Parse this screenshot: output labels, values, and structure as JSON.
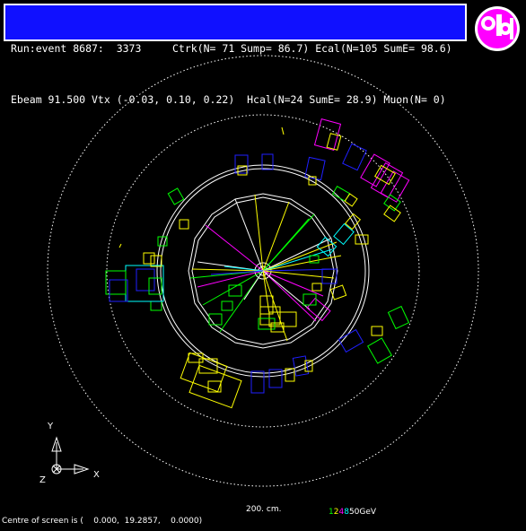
{
  "header": {
    "line1": "Run:event 8687:  3373     Ctrk(N= 71 Sump= 86.7) Ecal(N=105 SumE= 98.6)",
    "line2": "Ebeam 91.500 Vtx (-0.03, 0.10, 0.22)  Hcal(N=24 SumE= 28.9) Muon(N= 0)"
  },
  "axes": {
    "y": "Y",
    "x": "X",
    "z": "Z"
  },
  "scale_bar": {
    "label": "200. cm."
  },
  "energy_scale": {
    "n1": "1",
    "n2": "2",
    "n4": "4",
    "n8": "8",
    "n50": "50",
    "unit": "GeV"
  },
  "footer": {
    "centre_text": "Centre of screen is (    0.000,  19.2857,    0.0000)"
  },
  "colors": {
    "background": "#000000",
    "header_bg": "#1010ff",
    "track_yellow": "#ffff00",
    "track_green": "#00ff00",
    "track_magenta": "#ff00ff",
    "track_cyan": "#00ffff",
    "track_blue": "#2020ff",
    "logo_magenta": "#ff00ff"
  },
  "icons": {
    "logo": "opal-logo-icon"
  }
}
